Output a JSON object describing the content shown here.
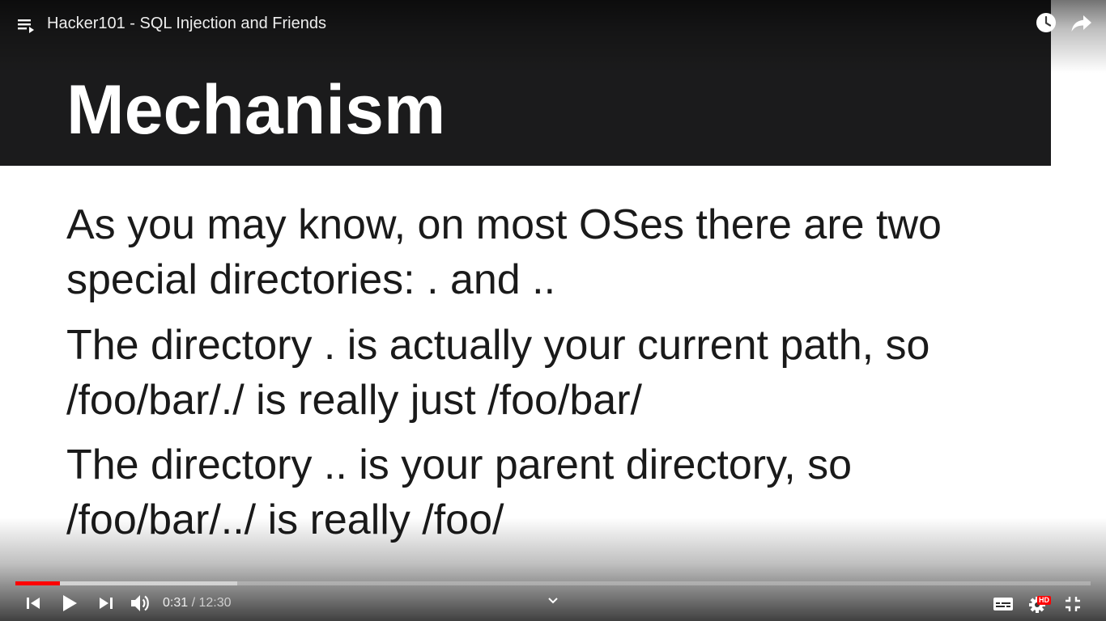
{
  "player": {
    "title": "Hacker101 - SQL Injection and Friends",
    "accent_color": "#ff0000",
    "progress": {
      "played_fraction": 0.0413,
      "buffered_fraction": 0.206
    },
    "time": {
      "current": "0:31",
      "separator": "/",
      "duration": "12:30"
    },
    "hd_badge": "HD",
    "icons": {
      "playlist": "playlist-icon",
      "watch_later": "clock-icon",
      "share": "share-arrow-icon",
      "previous": "skip-previous-icon",
      "play": "play-icon",
      "next": "skip-next-icon",
      "volume": "volume-icon",
      "expand": "chevron-down-icon",
      "captions": "subtitles-icon",
      "settings": "gear-icon",
      "exit_fullscreen": "exit-fullscreen-icon"
    }
  },
  "slide": {
    "title": "Mechanism",
    "header_color": "#1b1b1c",
    "lines": [
      "As you may know, on most OSes there are two",
      "special directories: . and ..",
      "The directory . is actually your current path, so",
      "/foo/bar/./ is really just /foo/bar/",
      "The directory .. is your parent directory, so",
      "/foo/bar/../ is really /foo/"
    ]
  }
}
